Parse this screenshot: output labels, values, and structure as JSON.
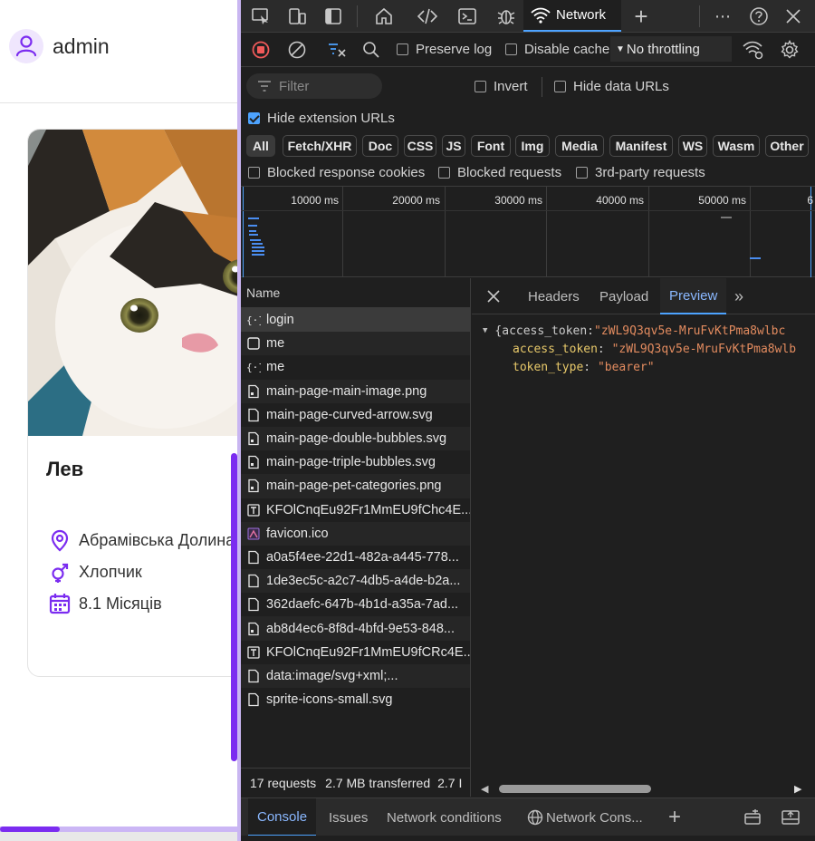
{
  "app": {
    "username": "admin",
    "pet": {
      "name": "Лев",
      "location": "Абрамівська Долина",
      "gender": "Хлопчик",
      "age": "8.1 Місяців"
    }
  },
  "devtools": {
    "active_panel": "Network",
    "toolbar": {
      "preserve_log": "Preserve log",
      "disable_cache": "Disable cache",
      "throttling": "No throttling"
    },
    "filter": {
      "placeholder": "Filter",
      "invert": "Invert",
      "hide_data_urls": "Hide data URLs",
      "hide_extension_urls": "Hide extension URLs",
      "hide_extension_urls_checked": true
    },
    "type_filters": [
      "All",
      "Fetch/XHR",
      "Doc",
      "CSS",
      "JS",
      "Font",
      "Img",
      "Media",
      "Manifest",
      "WS",
      "Wasm",
      "Other"
    ],
    "active_type_filter": "All",
    "extra_filters": [
      "Blocked response cookies",
      "Blocked requests",
      "3rd-party requests"
    ],
    "timeline_labels": [
      "10000 ms",
      "20000 ms",
      "30000 ms",
      "40000 ms",
      "50000 ms",
      "6"
    ],
    "requests_header": "Name",
    "requests": [
      {
        "name": "login",
        "icon": "fetch-icon"
      },
      {
        "name": "me",
        "icon": "document-icon"
      },
      {
        "name": "me",
        "icon": "fetch-icon"
      },
      {
        "name": "main-page-main-image.png",
        "icon": "image-file-icon"
      },
      {
        "name": "main-page-curved-arrow.svg",
        "icon": "file-icon"
      },
      {
        "name": "main-page-double-bubbles.svg",
        "icon": "image-file-icon"
      },
      {
        "name": "main-page-triple-bubbles.svg",
        "icon": "image-file-icon"
      },
      {
        "name": "main-page-pet-categories.png",
        "icon": "image-file-icon"
      },
      {
        "name": "KFOlCnqEu92Fr1MmEU9fChc4E...",
        "icon": "font-icon"
      },
      {
        "name": "favicon.ico",
        "icon": "favicon-icon"
      },
      {
        "name": "a0a5f4ee-22d1-482a-a445-778...",
        "icon": "file-icon"
      },
      {
        "name": "1de3ec5c-a2c7-4db5-a4de-b2a...",
        "icon": "file-icon"
      },
      {
        "name": "362daefc-647b-4b1d-a35a-7ad...",
        "icon": "file-icon"
      },
      {
        "name": "ab8d4ec6-8f8d-4bfd-9e53-848...",
        "icon": "image-file-icon"
      },
      {
        "name": "KFOlCnqEu92Fr1MmEU9fCRc4E...",
        "icon": "font-icon"
      },
      {
        "name": "data:image/svg+xml;...",
        "icon": "file-icon"
      },
      {
        "name": "sprite-icons-small.svg",
        "icon": "file-icon"
      }
    ],
    "status": {
      "requests": "17 requests",
      "transferred": "2.7 MB transferred",
      "resources": "2.7 I"
    },
    "detail_tabs": [
      "Headers",
      "Payload",
      "Preview"
    ],
    "active_detail_tab": "Preview",
    "preview": {
      "summary_open": "{access_token: ",
      "summary_value": "\"zWL9Q3qv5e-MruFvKtPma8wlbc",
      "access_token_key": "access_token",
      "access_token_value": "\"zWL9Q3qv5e-MruFvKtPma8wlb",
      "token_type_key": "token_type",
      "token_type_value": "\"bearer\""
    },
    "drawer_tabs": [
      "Console",
      "Issues",
      "Network conditions",
      "Network Cons..."
    ],
    "active_drawer_tab": "Console",
    "accent_color": "#4da3ff"
  }
}
